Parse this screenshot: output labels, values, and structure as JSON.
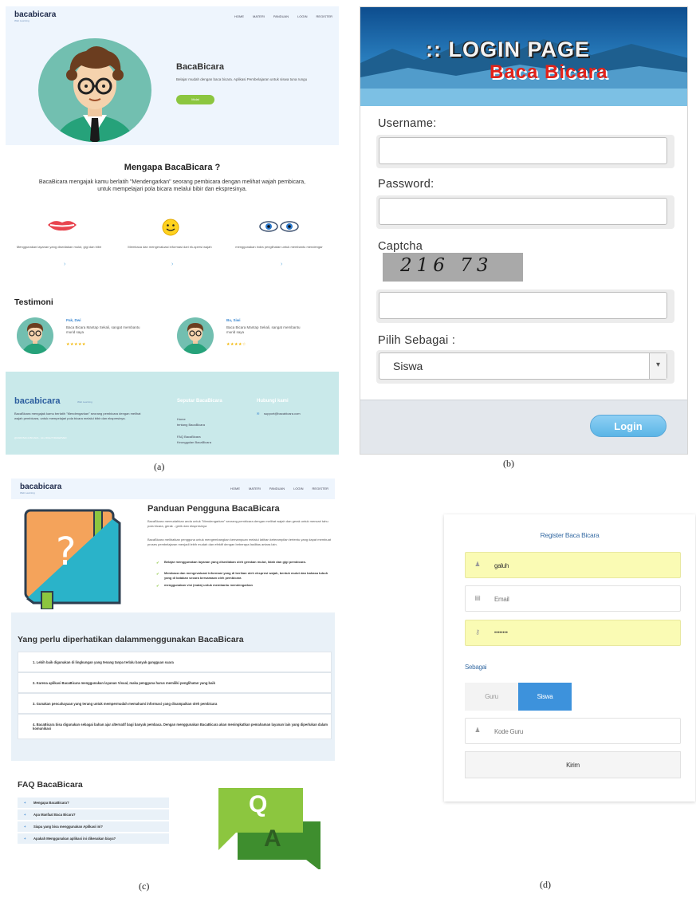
{
  "captions": {
    "a": "(a)",
    "b": "(b)",
    "c": "(c)",
    "d": "(d)"
  },
  "site": {
    "brand": "bacabicara",
    "brand_sub": "Web Learning",
    "nav": [
      "HOME",
      "MATERI",
      "PANDUAN",
      "LOGIN",
      "REGISTER"
    ]
  },
  "panel_a": {
    "hero_title": "BacaBicara",
    "hero_desc": "Belajar mudah dengan baca bicara. Aplikasi Pembelajaran untuk siswa tuna rungu",
    "hero_button": "Mulai",
    "why_title": "Mengapa BacaBicara ?",
    "why_desc_1": "BacaBicara mengajak kamu berlatih \"Mendengarkan\" seorang pembicara dengan melihat wajah pembicara,",
    "why_desc_2": "untuk mempelajari pola bicara melalui bibir dan ekspresinya.",
    "features": [
      {
        "icon": "lips-icon",
        "text": "Menggunakan layanan yang disediakan mulut, gigi dan bibir",
        "link": "›"
      },
      {
        "icon": "smiley-icon",
        "text": "Membaca dan mengevaluasi informasi dari ek-spresi wajah",
        "link": "›"
      },
      {
        "icon": "eyes-icon",
        "text": "menggunakan indra penglihatan untuk membantu mendengar",
        "link": "›"
      }
    ],
    "testimoni_title": "Testimoni",
    "testimonials": [
      {
        "name": "Pak, Dwi",
        "text": "Baca Bicara Mantap Sekali, sangat membantu murid saya",
        "stars": "★★★★★"
      },
      {
        "name": "Bu, Siwi",
        "text": "Baca Bicara Mantap Sekali, sangat membantu murid saya",
        "stars": "★★★★☆"
      }
    ],
    "footer": {
      "brand": "bacabicara",
      "brand_sub": "Web Learning",
      "desc": "BacaBicara mengajak kamu berlatih \"Mendengarkan\" seorang pembicara dengan melihat wajah pembicara, untuk mempelajari pola bicara melalui bibir dan ekspresinya.",
      "copy": "@2020 BACA BICARA · ALL RIGHT RESERVED",
      "col1_title": "Seputar BacaBicara",
      "col1_links": [
        "Home",
        "tentang BacaBicara",
        "FAQ BacaBicara",
        "Keunggulan BacaBicara"
      ],
      "col2_title": "Hubungi kami",
      "email": "support@bacabicara.com"
    }
  },
  "panel_b": {
    "banner_line1": ":: LOGIN PAGE",
    "banner_line2": "Baca Bicara",
    "username_label": "Username:",
    "password_label": "Password:",
    "captcha_label": "Captcha",
    "captcha_text": "216 73",
    "role_label": "Pilih Sebagai :",
    "role_value": "Siswa",
    "login_button": "Login"
  },
  "panel_c": {
    "title": "Panduan Pengguna BacaBicara",
    "para1": "BacaBicara memudahkan anda untuk \"Mendengarkan\" seorang pembicara dengan melihat wajah dan gerak untuk mencari tahu pola bicara, gerak - gerik dan ekspresinya",
    "para2": "BacaBicara melibatkan pengguna untuk mengembangkan kemampuan melalui latihan keterampilan tertentu yang dapat membuat proses pembelajaran menjadi lebih mudah dan efektif dengan beberapa fasilitas antara lain.",
    "checks": [
      "Belajar menggunakan layanan yang disediakan oleh gerakan mulut, lidah dan gigi pembicara.",
      "Membaca dan mengevaluasi informasi yang di berikan oleh ekspresi wajah, bentuk mulut dan bahasa tubuh yang di katakan secara bersamaan oleh pembicara",
      "menggunakan visi (mata) untuk membantu mendengarkan"
    ],
    "attention_title": "Yang perlu diperhatikan dalammenggunakan BacaBicara",
    "attention_items": [
      "1. Lebih baik digunakan di lingkungan yang tenang tanpa terlalu banyak gangguan suara",
      "2. Karena aplikasi BacaBicara menggunakan layanan Visual, maka pengguna harus memiliki penglihatan yang baik",
      "3. Gunakan pencahayaan yang terang untuk mempermudah memahami informasi yang disampaikan oleh pembicara",
      "4. BacaBicara bisa digunakan sebagai bahan ajar alternatif bagi banyak pembaca. Dengan menggunakan BacaBicara akan meningkatkan pemahaman layanan lain yang diperlukan dalam komunikasi"
    ],
    "faq_title": "FAQ BacaBicara",
    "faq_items": [
      "Mengapa BacaBicara?",
      "Apa Manfaat Baca Bicara?",
      "Siapa yang bisa menggunakan Aplikasi ini?",
      "Apakah Menggunakan aplikasi ini dikenakan biaya?"
    ],
    "qa_q": "Q",
    "qa_a": "A"
  },
  "panel_d": {
    "title": "Register Baca Bicara",
    "name_value": "galuh",
    "email_placeholder": "Email",
    "password_value": "••••••••",
    "role_label": "Sebagai",
    "role_options": [
      "Guru",
      "Siswa"
    ],
    "selected_role": "Siswa",
    "teacher_code_placeholder": "Kode Guru",
    "submit": "Kirim"
  },
  "colors": {
    "accent_green": "#8cc63f",
    "accent_blue": "#3a87d1",
    "selected_toggle": "#3d92dc",
    "autofill_yellow": "#fafbb4",
    "footer_teal": "#c9e9ea"
  }
}
